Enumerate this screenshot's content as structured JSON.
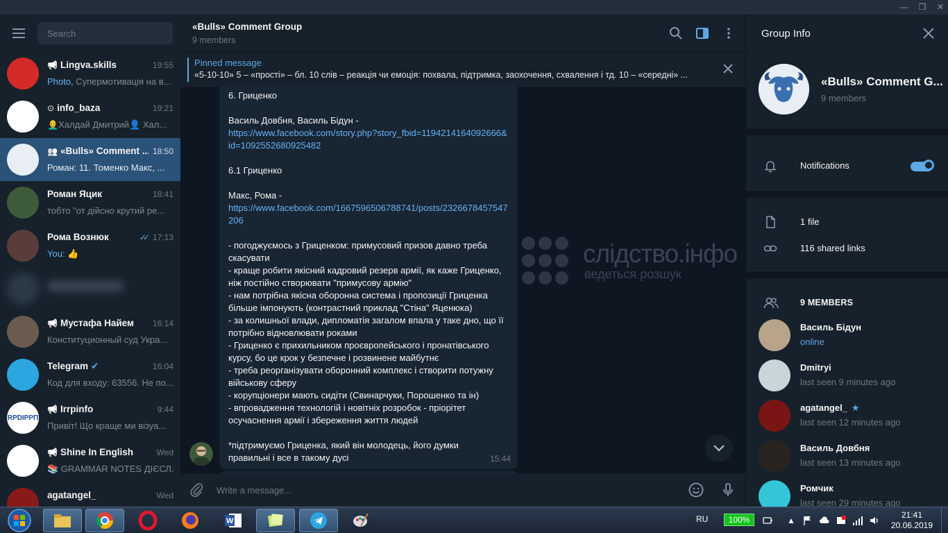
{
  "window": {
    "minimize_glyph": "—",
    "restore_glyph": "❐",
    "close_glyph": "✕"
  },
  "sidebar": {
    "search_placeholder": "Search",
    "chats": [
      {
        "name": "Lingva.skills",
        "type": "channel",
        "time": "19:55",
        "preview_highlight": "Photo,",
        "preview": " Супермотивація на в...",
        "avatar_color": "#d42a2a",
        "avatar_text": ""
      },
      {
        "name": "info_baza",
        "type": "bot",
        "time": "19:21",
        "preview_highlight": "",
        "preview": "👨‍🦲Халдай Дмитрий👤 Хал...",
        "avatar_color": "#ffffff",
        "avatar_text": ""
      },
      {
        "name": "«Bulls» Comment ...",
        "type": "group",
        "time": "18:50",
        "preview_highlight": "",
        "preview": "Роман: 11. Томенко  Макс, ...",
        "avatar_color": "#e8eef4",
        "avatar_text": "",
        "active": true
      },
      {
        "name": "Роман Яцик",
        "type": "user",
        "time": "18:41",
        "preview_highlight": "",
        "preview": "тобто \"от дійсно крутий ре...",
        "avatar_color": "#3d5a3a",
        "avatar_text": ""
      },
      {
        "name": "Рома Вознюк",
        "type": "user",
        "time": "17:13",
        "preview_highlight": "You:",
        "preview": " 👍",
        "avatar_color": "#5a3d3a",
        "avatar_text": "",
        "read": true
      },
      {
        "name": "",
        "type": "blurred",
        "time": "",
        "preview_highlight": "",
        "preview": "",
        "avatar_color": "#3a4a5a",
        "avatar_text": ""
      },
      {
        "name": "Мустафа Найем",
        "type": "channel",
        "time": "16:14",
        "preview_highlight": "",
        "preview": "Конституционный суд Укра...",
        "avatar_color": "#6a5a50",
        "avatar_text": ""
      },
      {
        "name": "Telegram",
        "type": "verified",
        "time": "16:04",
        "preview_highlight": "",
        "preview": "Код для входу: 63556. Не по...",
        "avatar_color": "#2ca5e0",
        "avatar_text": ""
      },
      {
        "name": "Irrpinfo",
        "type": "channel",
        "time": "9:44",
        "preview_highlight": "",
        "preview": "Привіт!  Що краще ми візуа...",
        "avatar_color": "#ffffff",
        "avatar_text": "RPDIPPП"
      },
      {
        "name": "Shine In English",
        "type": "channel",
        "time": "Wed",
        "preview_highlight": "",
        "preview": "📚 GRAMMAR NOTES ДІЄСЛ...",
        "avatar_color": "#ffffff",
        "avatar_text": ""
      },
      {
        "name": "agatangel_",
        "type": "user",
        "time": "Wed",
        "preview_highlight": "",
        "preview": "",
        "avatar_color": "#8a1a1a",
        "avatar_text": ""
      }
    ]
  },
  "chat": {
    "title": "«Bulls» Comment Group",
    "subtitle": "9 members",
    "pinned_title": "Pinned message",
    "pinned_text": "«5-10-10»  5 – «прості» – бл. 10 слів – реакція чи емоція: похвала, підтримка, заохочення, схвалення і тд. 10 – «середні» ...",
    "message": {
      "line1": "6. Гриценко",
      "line2": "Василь Довбня, Василь Бідун -",
      "link1": "https://www.facebook.com/story.php?story_fbid=1194214164092666&id=1092552680925482",
      "line3": "6.1 Гриценко",
      "line4": "Макс, Рома -",
      "link2": "https://www.facebook.com/1667596506788741/posts/2326678457547206",
      "body": "- погоджуємось з Гриценком: примусовий призов давно треба скасувати\n- краще робити якісний кадровий резерв армії, як каже Гриценко, ніж постійно створювати \"примусову армію\"\n- нам потрібна якісна оборонна система і пропозиції Гриценка більше імпонують (контрастний приклад \"Стіна\" Яценюка)\n- за колишньої влади, дипломатія загалом впала у таке дно, що її потрібно відновлювати роками\n- Гриценко є прихильником проєвропейського і пронатівського курсу, бо це крок у безпечне і розвинене майбутнє\n- треба реорганізувати оборонний комплекс і створити потужну військову сферу\n- корупціонери мають сидіти (Свинарчуки, Порошенко та ін)\n- впровадження технологій і новітніх розробок - пріорітет осучаснення армії і збереження життя людей",
      "footer": "*підтримуємо Гриценка, який він молодець, його думки правильні і все в такому дусі",
      "time": "15:44"
    },
    "watermark_title": "слідство.інфо",
    "watermark_sub": "ведеться розшук",
    "composer_placeholder": "Write a message..."
  },
  "info": {
    "title": "Group Info",
    "group_name": "«Bulls» Comment G...",
    "members_count": "9 members",
    "notifications_label": "Notifications",
    "notifications_on": true,
    "files_label": "1 file",
    "links_label": "116 shared links",
    "members_header": "9 MEMBERS",
    "members": [
      {
        "name": "Василь Бідун",
        "status": "online",
        "online": true,
        "avatar_color": "#b8a48a"
      },
      {
        "name": "Dmitryi",
        "status": "last seen 9 minutes ago",
        "online": false,
        "avatar_color": "#c9d5d8"
      },
      {
        "name": "agatangel_",
        "status": "last seen 12 minutes ago",
        "online": false,
        "avatar_color": "#7a1515",
        "star": "★"
      },
      {
        "name": "Василь Довбня",
        "status": "last seen 13 minutes ago",
        "online": false,
        "avatar_color": "#2a2420"
      },
      {
        "name": "Ромчик",
        "status": "last seen 29 minutes ago",
        "online": false,
        "avatar_color": "#33c6d9"
      }
    ]
  },
  "taskbar": {
    "language": "RU",
    "battery": "100%",
    "time": "21:41",
    "date": "20.06.2019"
  }
}
